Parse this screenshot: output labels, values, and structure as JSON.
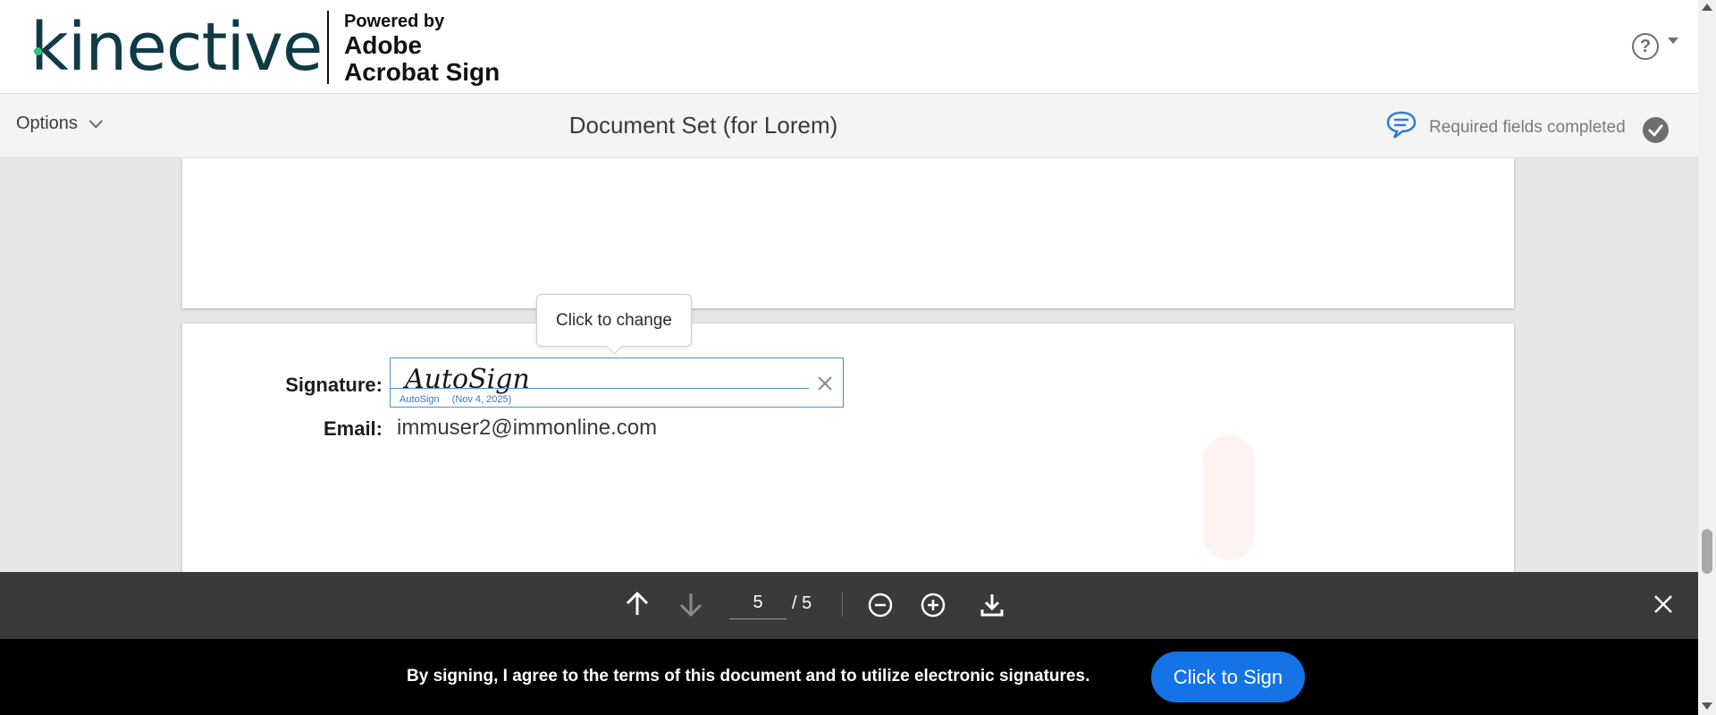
{
  "header": {
    "brand": "kinective",
    "powered_line1": "Powered by",
    "powered_line2": "Adobe",
    "powered_line3": "Acrobat Sign",
    "help_symbol": "?",
    "help_icon": "help-circle-icon"
  },
  "subheader": {
    "options_label": "Options",
    "document_title": "Document Set (for Lorem)",
    "required_status": "Required fields completed",
    "comment_icon": "speech-bubble-icon",
    "check_icon": "check-circle-icon"
  },
  "document": {
    "signature_label": "Signature:",
    "signature_value": "AutoSign",
    "signature_signer": "AutoSign",
    "signature_date": "(Nov 4, 2025)",
    "email_label": "Email:",
    "email_value": "immuser2@immonline.com",
    "tooltip": "Click to change"
  },
  "toolbar": {
    "current_page": "5",
    "total_pages": "/ 5",
    "icons": [
      "arrow-up-icon",
      "arrow-down-icon",
      "zoom-out-icon",
      "zoom-in-icon",
      "download-icon",
      "close-icon"
    ]
  },
  "signbar": {
    "consent_text": "By signing, I agree to the terms of this document and to utilize electronic signatures.",
    "sign_button": "Click to Sign"
  },
  "colors": {
    "brand_teal": "#0f3b46",
    "accent_blue": "#1473e6",
    "toolbar_bg": "#3a3a3a"
  }
}
